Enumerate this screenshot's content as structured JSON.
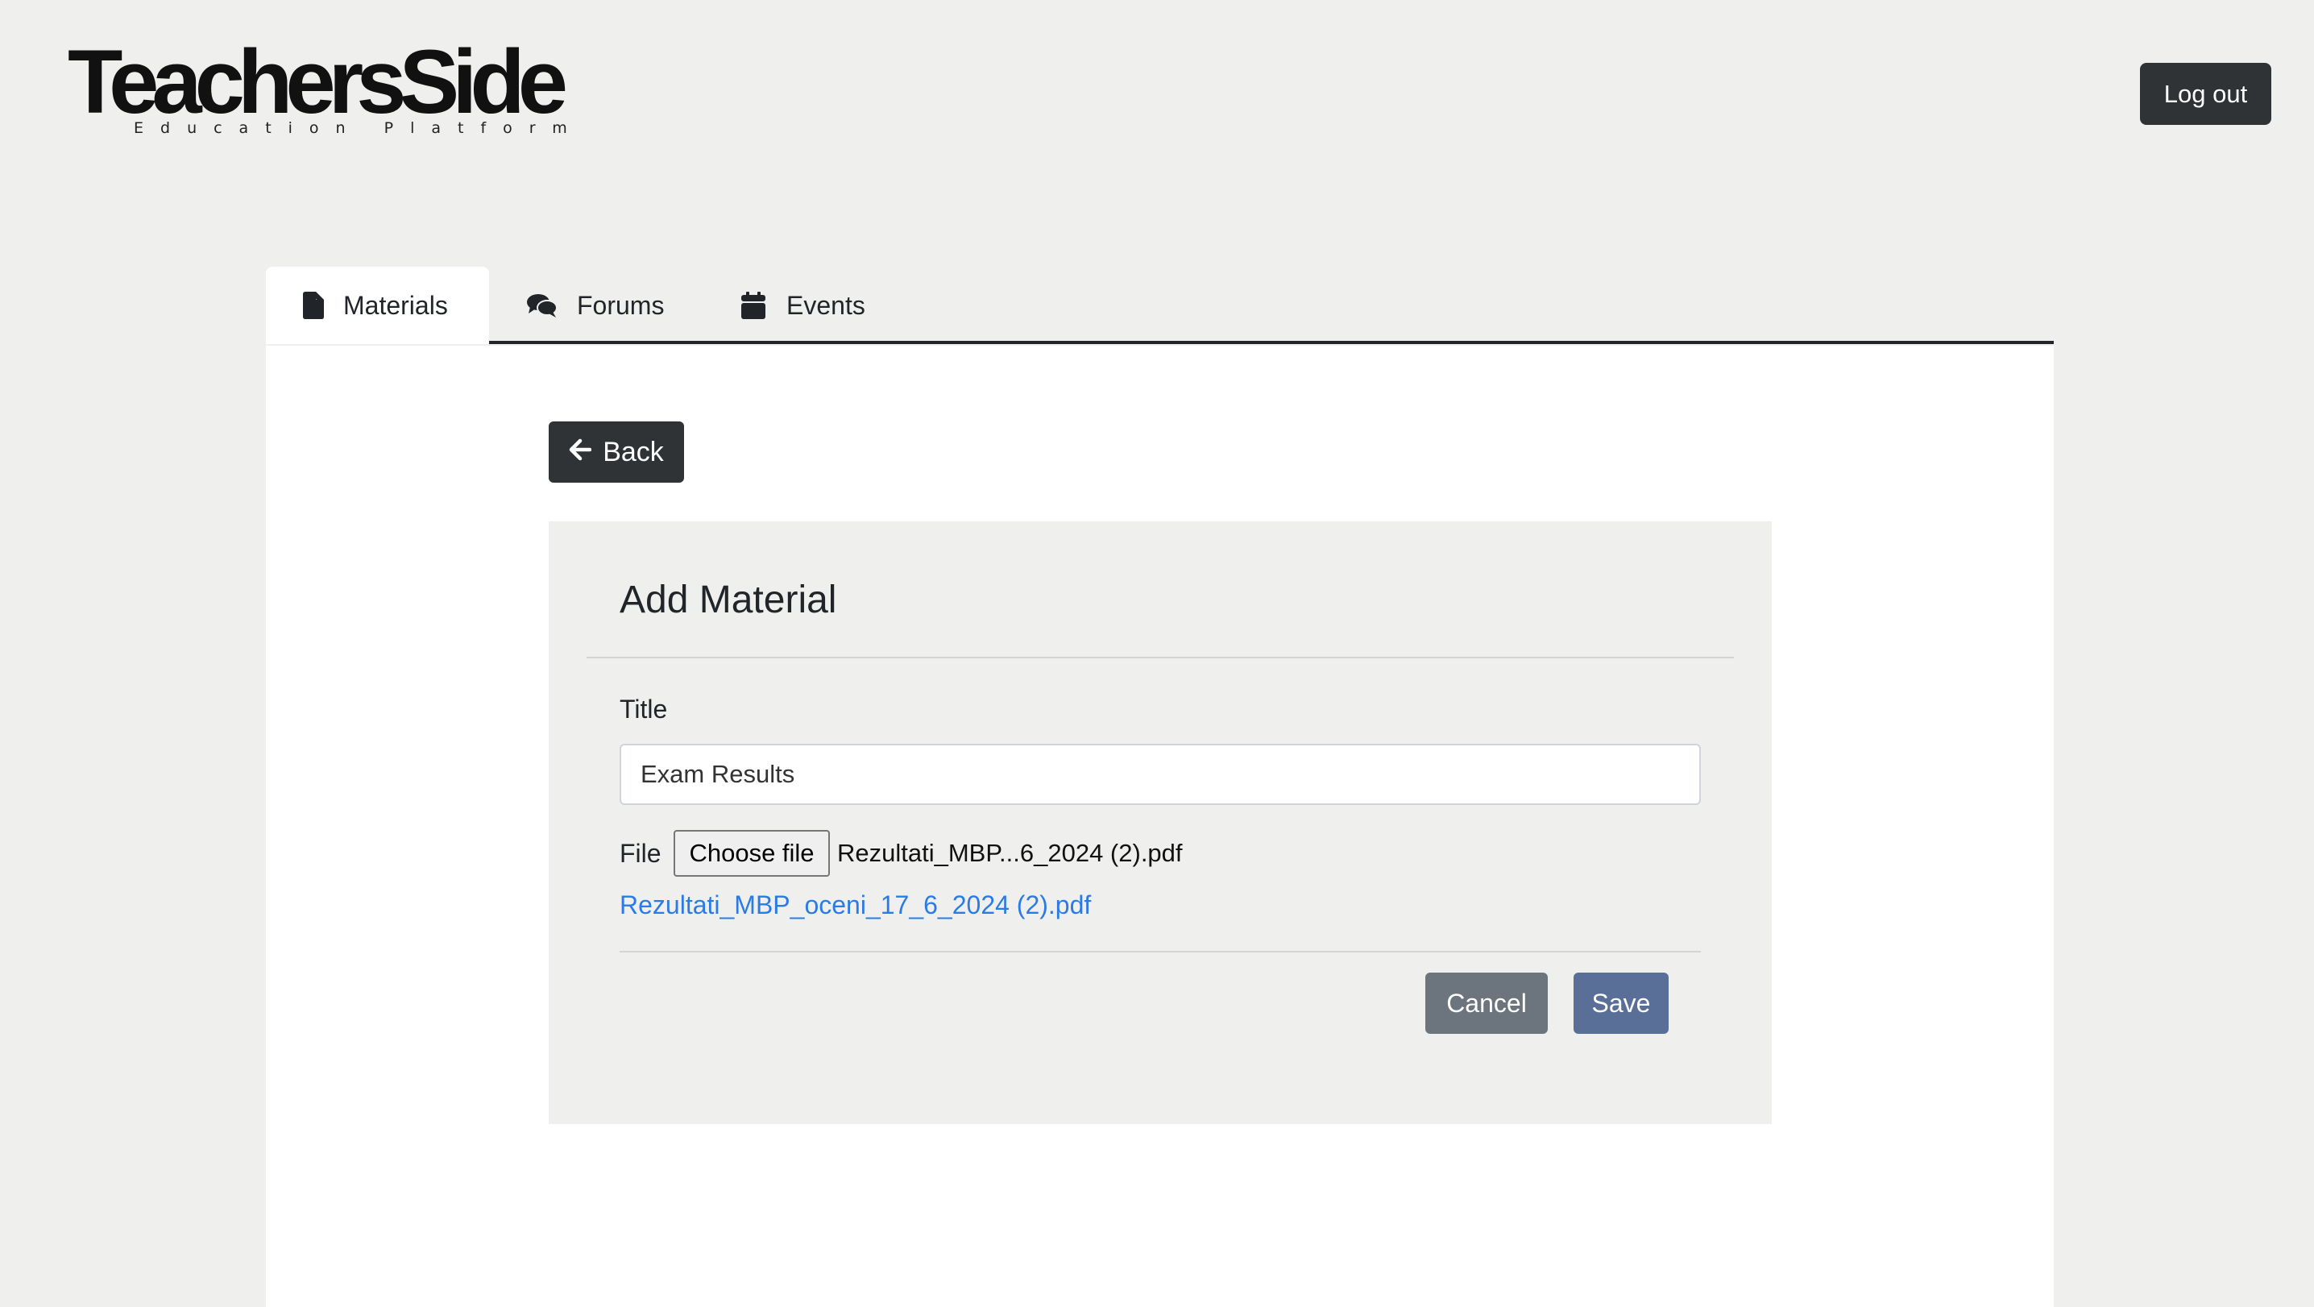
{
  "brand": {
    "name": "TeachersSide",
    "tagline": "Education Platform"
  },
  "header": {
    "logout_label": "Log out"
  },
  "tabs": [
    {
      "label": "Materials",
      "icon": "file-icon",
      "active": true
    },
    {
      "label": "Forums",
      "icon": "comments-icon",
      "active": false
    },
    {
      "label": "Events",
      "icon": "calendar-icon",
      "active": false
    }
  ],
  "back_button": {
    "label": "Back",
    "icon": "arrow-left-icon"
  },
  "form": {
    "heading": "Add Material",
    "title_label": "Title",
    "title_value": "Exam Results",
    "file_label": "File",
    "choose_file_label": "Choose file",
    "chosen_file_display": "Rezultati_MBP...6_2024 (2).pdf",
    "existing_file_link": "Rezultati_MBP_oceni_17_6_2024 (2).pdf",
    "cancel_label": "Cancel",
    "save_label": "Save"
  },
  "colors": {
    "page_background": "#eff0ee",
    "dark_button": "#2f3335",
    "cancel_button": "#6c757d",
    "save_button": "#5a6f97",
    "link": "#2c7be5"
  }
}
